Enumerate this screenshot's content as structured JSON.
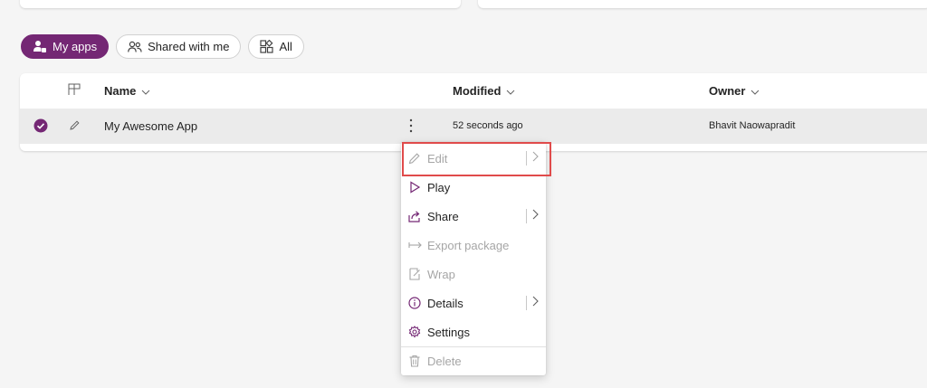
{
  "filters": [
    {
      "label": "My apps",
      "icon": "user-apps-icon",
      "active": true
    },
    {
      "label": "Shared with me",
      "icon": "people-icon",
      "active": false
    },
    {
      "label": "All",
      "icon": "apps-grid-icon",
      "active": false
    }
  ],
  "grid": {
    "columns": {
      "name": "Name",
      "modified": "Modified",
      "owner": "Owner"
    },
    "rows": [
      {
        "name": "My Awesome App",
        "modified": "52 seconds ago",
        "owner": "Bhavit Naowapradit",
        "selected": true
      }
    ]
  },
  "context_menu": {
    "items": [
      {
        "label": "Edit",
        "icon": "pencil-icon",
        "disabled": true,
        "submenu": true
      },
      {
        "label": "Play",
        "icon": "play-icon",
        "disabled": false,
        "submenu": false
      },
      {
        "label": "Share",
        "icon": "share-icon",
        "disabled": false,
        "submenu": true
      },
      {
        "label": "Export package",
        "icon": "export-arrow-icon",
        "disabled": true,
        "submenu": false
      },
      {
        "label": "Wrap",
        "icon": "wrap-icon",
        "disabled": true,
        "submenu": false
      },
      {
        "label": "Details",
        "icon": "info-icon",
        "disabled": false,
        "submenu": true
      },
      {
        "label": "Settings",
        "icon": "gear-icon",
        "disabled": false,
        "submenu": false
      },
      {
        "label": "Delete",
        "icon": "trash-icon",
        "disabled": true,
        "submenu": false
      }
    ]
  },
  "colors": {
    "accent": "#742774",
    "highlight_border": "#e04b4b",
    "row_selected_bg": "#ebebeb",
    "disabled_text": "#a6a6a6"
  }
}
